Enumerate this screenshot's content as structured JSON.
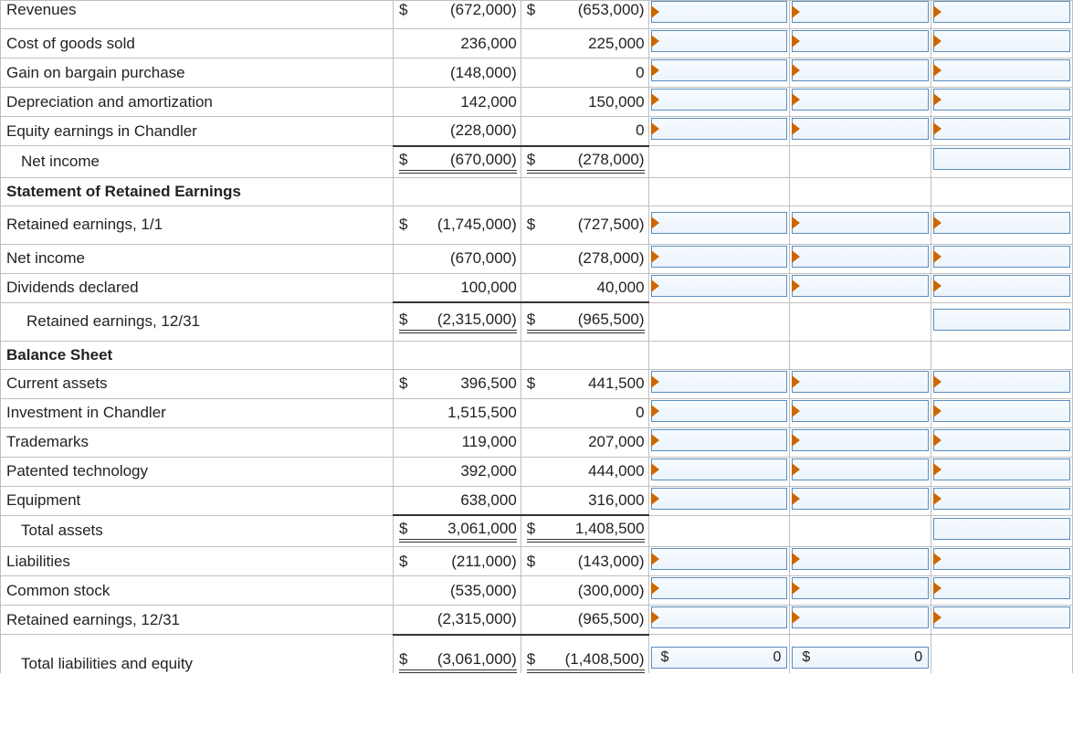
{
  "rows": [
    {
      "label": "Revenues",
      "c1": {
        "d": "$",
        "v": "(672,000)"
      },
      "c2": {
        "d": "$",
        "v": "(653,000)"
      },
      "inputs": [
        true,
        true,
        true
      ],
      "cutoff": true
    },
    {
      "label": "Cost of goods sold",
      "c1": {
        "v": "236,000"
      },
      "c2": {
        "v": "225,000"
      },
      "inputs": [
        true,
        true,
        true
      ]
    },
    {
      "label": "Gain on bargain purchase",
      "c1": {
        "v": "(148,000)"
      },
      "c2": {
        "v": "0"
      },
      "inputs": [
        true,
        true,
        true
      ]
    },
    {
      "label": "Depreciation and amortization",
      "c1": {
        "v": "142,000"
      },
      "c2": {
        "v": "150,000"
      },
      "inputs": [
        true,
        true,
        true
      ]
    },
    {
      "label": "Equity earnings in Chandler",
      "c1": {
        "v": "(228,000)"
      },
      "c2": {
        "v": "0"
      },
      "inputs": [
        true,
        true,
        true
      ]
    },
    {
      "label": "Net income",
      "indent": 1,
      "c1": {
        "d": "$",
        "v": "(670,000)"
      },
      "c2": {
        "d": "$",
        "v": "(278,000)"
      },
      "ulTop": true,
      "dbl": true,
      "inputs": [
        false,
        false,
        "noarrow"
      ]
    },
    {
      "label": "Statement of Retained Earnings",
      "bold": true,
      "section": true
    },
    {
      "label": "Retained earnings, 1/1",
      "tall": true,
      "c1": {
        "d": "$",
        "v": "(1,745,000)"
      },
      "c2": {
        "d": "$",
        "v": "(727,500)"
      },
      "inputs": [
        true,
        true,
        true
      ]
    },
    {
      "label": "Net income",
      "c1": {
        "v": "(670,000)"
      },
      "c2": {
        "v": "(278,000)"
      },
      "inputs": [
        true,
        true,
        true
      ]
    },
    {
      "label": "Dividends declared",
      "c1": {
        "v": "100,000"
      },
      "c2": {
        "v": "40,000"
      },
      "inputs": [
        true,
        true,
        true
      ]
    },
    {
      "label": "Retained earnings, 12/31",
      "indent": 2,
      "tall": true,
      "c1": {
        "d": "$",
        "v": "(2,315,000)"
      },
      "c2": {
        "d": "$",
        "v": "(965,500)"
      },
      "ulTop": true,
      "dbl": true,
      "inputs": [
        false,
        false,
        "noarrow"
      ]
    },
    {
      "label": "Balance Sheet",
      "bold": true,
      "section": true
    },
    {
      "label": "Current assets",
      "c1": {
        "d": "$",
        "v": "396,500"
      },
      "c2": {
        "d": "$",
        "v": "441,500"
      },
      "inputs": [
        true,
        true,
        true
      ]
    },
    {
      "label": "Investment in Chandler",
      "c1": {
        "v": "1,515,500"
      },
      "c2": {
        "v": "0"
      },
      "inputs": [
        true,
        true,
        true
      ]
    },
    {
      "label": "Trademarks",
      "c1": {
        "v": "119,000"
      },
      "c2": {
        "v": "207,000"
      },
      "inputs": [
        true,
        true,
        true
      ]
    },
    {
      "label": "Patented technology",
      "c1": {
        "v": "392,000"
      },
      "c2": {
        "v": "444,000"
      },
      "inputs": [
        true,
        true,
        true
      ]
    },
    {
      "label": "Equipment",
      "c1": {
        "v": "638,000"
      },
      "c2": {
        "v": "316,000"
      },
      "inputs": [
        true,
        true,
        true
      ]
    },
    {
      "label": "Total assets",
      "indent": 1,
      "c1": {
        "d": "$",
        "v": "3,061,000"
      },
      "c2": {
        "d": "$",
        "v": "1,408,500"
      },
      "ulTop": true,
      "dbl": true,
      "inputs": [
        false,
        false,
        "noarrow"
      ]
    },
    {
      "label": "Liabilities",
      "c1": {
        "d": "$",
        "v": "(211,000)"
      },
      "c2": {
        "d": "$",
        "v": "(143,000)"
      },
      "inputs": [
        true,
        true,
        true
      ]
    },
    {
      "label": "Common stock",
      "c1": {
        "v": "(535,000)"
      },
      "c2": {
        "v": "(300,000)"
      },
      "inputs": [
        true,
        true,
        true
      ]
    },
    {
      "label": "Retained earnings, 12/31",
      "c1": {
        "v": "(2,315,000)"
      },
      "c2": {
        "v": "(965,500)"
      },
      "inputs": [
        true,
        true,
        true
      ]
    },
    {
      "label": "Total liabilities and equity",
      "indent": 1,
      "tall": true,
      "c1": {
        "d": "$",
        "v": "(3,061,000)"
      },
      "c2": {
        "d": "$",
        "v": "(1,408,500)"
      },
      "ulTop": true,
      "dbl": true,
      "inputs": [
        {
          "d": "$",
          "v": "0",
          "noarrow": true
        },
        {
          "d": "$",
          "v": "0",
          "noarrow": true
        },
        false
      ],
      "cutoffBottom": true
    }
  ]
}
